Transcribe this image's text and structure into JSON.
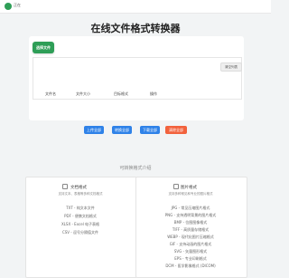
{
  "header": {
    "logo_text": "正在"
  },
  "page_title": "在线文件格式转换器",
  "upload": {
    "select_button": "选择文件",
    "clear_list_button": "清空列表",
    "table_headers": [
      "文件名",
      "文件大小",
      "目标格式",
      "操作"
    ]
  },
  "actions": {
    "upload_all": "上传全部",
    "convert_all": "转换全部",
    "download_all": "下载全部",
    "clear_all": "清除全部"
  },
  "colors": {
    "brand_green": "#2e9e57",
    "action_blue": "#2f82e8",
    "danger_orange": "#f2623d"
  },
  "formats_section": {
    "heading": "可转换格式介绍",
    "document": {
      "icon": "document-icon",
      "title": "文档格式",
      "desc": "支持文本、表格等多种文档格式",
      "items": [
        "TXT - 纯文本文件",
        "PDF - 便携文档格式",
        "XLSX - Excel 电子表格",
        "CSV - 逗号分隔值文件"
      ]
    },
    "image": {
      "icon": "image-icon",
      "title": "图片格式",
      "desc": "支持多种常见和专业的图片格式",
      "items": [
        "JPG - 常见压缩图片格式",
        "PNG - 支持透明背景的图片格式",
        "BMP - 位图图像格式",
        "TIFF - 高质量存储格式",
        "WEBP - 现代化图片压缩格式",
        "GIF - 支持动画的图片格式",
        "SVG - 矢量图形格式",
        "EPS - 专业印刷格式",
        "DCM - 医学影像格式 (DICOM)"
      ]
    }
  }
}
